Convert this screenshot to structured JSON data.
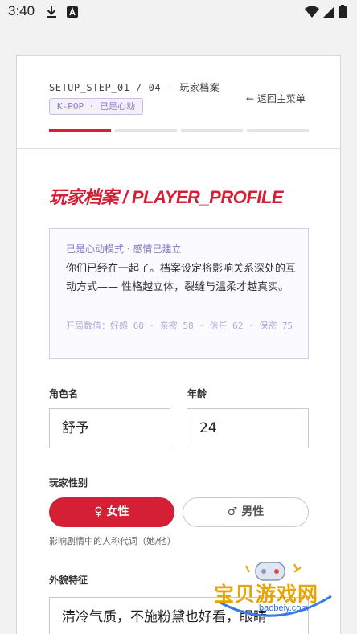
{
  "status_bar": {
    "time": "3:40",
    "icons": [
      "download-icon",
      "app-a-icon",
      "wifi-icon",
      "signal-icon",
      "battery-icon"
    ]
  },
  "header": {
    "step": "SETUP_STEP_01 / 04 — 玩家档案",
    "back": "← 返回主菜单",
    "tag": "K-POP · 已是心动",
    "progress": {
      "current": 1,
      "total": 4
    }
  },
  "page_title": "玩家档案 / PLAYER_PROFILE",
  "mood": {
    "head": "已是心动模式 · 感情已建立",
    "body": "你们已经在一起了。档案设定将影响关系深处的互动方式—— 性格越立体，裂缝与温柔才越真实。",
    "stats": "开局数值：好感 68 · 亲密 58 · 信任 62 · 保密 75"
  },
  "form": {
    "name_label": "角色名",
    "name_value": "舒予",
    "age_label": "年龄",
    "age_value": "24",
    "gender_label": "玩家性别",
    "gender_female": "♀ 女性",
    "gender_male": "♂ 男性",
    "gender_selected": "female",
    "gender_hint": "影响剧情中的人称代词（她/他）",
    "appearance_label": "外貌特征",
    "appearance_value": "清冷气质，不施粉黛也好看，眼睛"
  },
  "watermark": {
    "text": "宝贝游戏网",
    "url": "baobeiy.com"
  },
  "colors": {
    "accent": "#d41f35",
    "purple": "#8a79c4"
  }
}
